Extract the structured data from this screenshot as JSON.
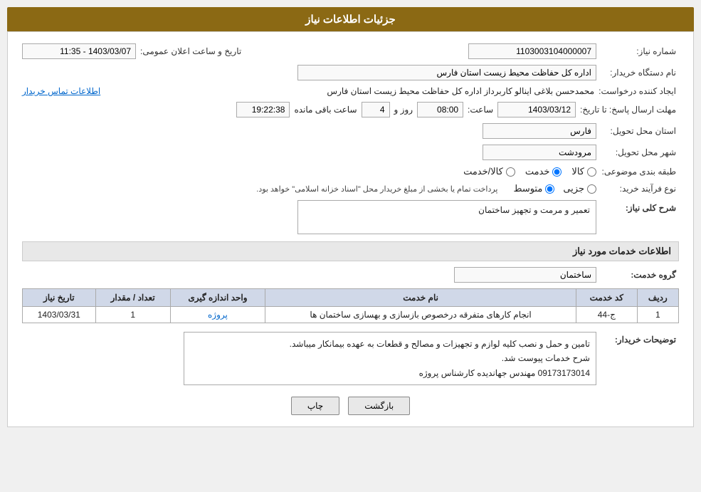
{
  "header": {
    "title": "جزئیات اطلاعات نیاز"
  },
  "form": {
    "need_number_label": "شماره نیاز:",
    "need_number_value": "1103003104000007",
    "date_label": "تاریخ و ساعت اعلان عمومی:",
    "date_value": "1403/03/07 - 11:35",
    "buyer_org_label": "نام دستگاه خریدار:",
    "buyer_org_value": "اداره کل حفاظت محیط زیست استان فارس",
    "requester_label": "ایجاد کننده درخواست:",
    "requester_value": "محمدحسن بلاغی اینالو کاربرداز اداره کل حفاظت محیط زیست استان فارس",
    "contact_link": "اطلاعات تماس خریدار",
    "deadline_label": "مهلت ارسال پاسخ: تا تاریخ:",
    "deadline_date": "1403/03/12",
    "deadline_time_label": "ساعت:",
    "deadline_time": "08:00",
    "deadline_days_label": "روز و",
    "deadline_days": "4",
    "deadline_remaining_label": "ساعت باقی مانده",
    "deadline_remaining": "19:22:38",
    "province_label": "استان محل تحویل:",
    "province_value": "فارس",
    "city_label": "شهر محل تحویل:",
    "city_value": "مرودشت",
    "category_label": "طبقه بندی موضوعی:",
    "category_options": [
      "کالا",
      "خدمت",
      "کالا/خدمت"
    ],
    "category_selected": "خدمت",
    "purchase_type_label": "نوع فرآیند خرید:",
    "purchase_types": [
      "جزیی",
      "متوسط"
    ],
    "purchase_type_selected": "متوسط",
    "purchase_note": "پرداخت تمام یا بخشی از مبلغ خریدار محل \"اسناد خزانه اسلامی\" خواهد بود.",
    "need_description_label": "شرح کلی نیاز:",
    "need_description_value": "تعمیر و مرمت و تجهیز ساختمان",
    "services_section_title": "اطلاعات خدمات مورد نیاز",
    "service_group_label": "گروه خدمت:",
    "service_group_value": "ساختمان",
    "table": {
      "headers": [
        "ردیف",
        "کد خدمت",
        "نام خدمت",
        "واحد اندازه گیری",
        "تعداد / مقدار",
        "تاریخ نیاز"
      ],
      "rows": [
        {
          "row": "1",
          "code": "ج-44",
          "name": "انجام کارهای متفرقه درخصوص بازسازی و بهسازی ساختمان ها",
          "unit": "پروژه",
          "count": "1",
          "date": "1403/03/31"
        }
      ]
    },
    "buyer_description_label": "توضیحات خریدار:",
    "buyer_description": "تامین و حمل و نصب کلیه لوازم و تجهیزات و مصالح و قطعات به عهده بیمانکار میباشد.\nشرح خدمات پیوست شد.\n09173173014 مهندس جهاندیده کارشناس پروژه",
    "btn_print": "چاپ",
    "btn_back": "بازگشت"
  }
}
